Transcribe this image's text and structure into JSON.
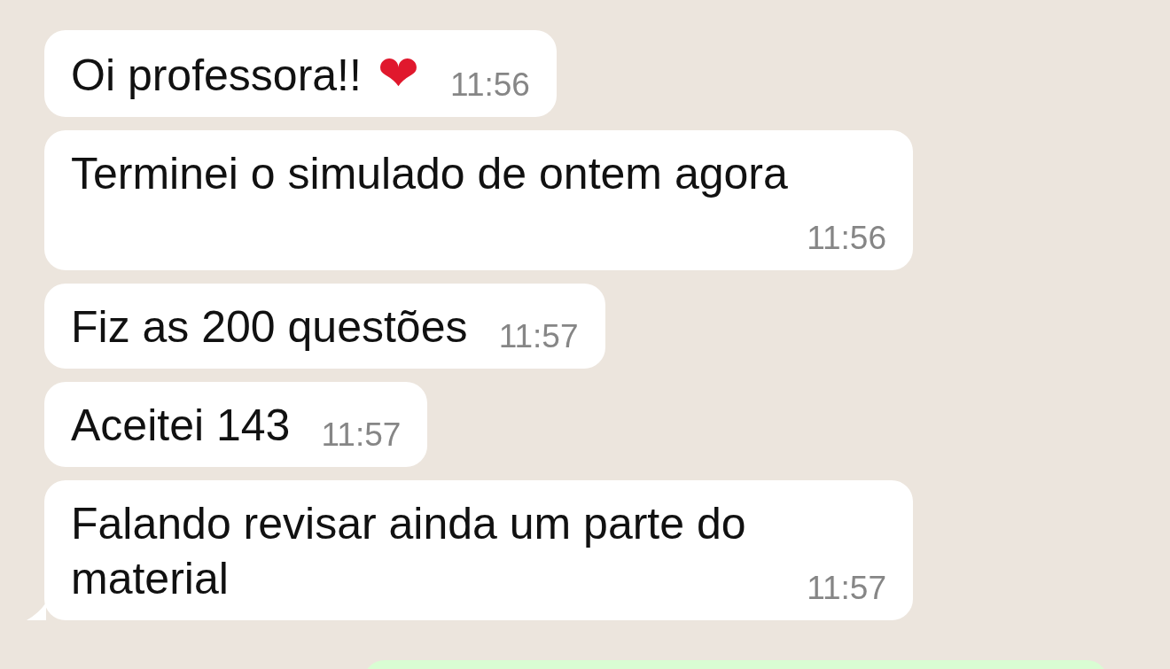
{
  "messages": [
    {
      "kind": "incoming",
      "text": "Oi professora!!",
      "emoji": "❤",
      "time": "11:56",
      "tail": false
    },
    {
      "kind": "incoming",
      "text": "Terminei o simulado de ontem agora",
      "time": "11:56",
      "tail": false
    },
    {
      "kind": "incoming",
      "text": "Fiz as 200 questões",
      "time": "11:57",
      "tail": false
    },
    {
      "kind": "incoming",
      "text": "Aceitei 143",
      "time": "11:57",
      "tail": false
    },
    {
      "kind": "incoming",
      "text": "Falando revisar ainda um parte do material",
      "time": "11:57",
      "tail": true
    },
    {
      "kind": "outgoing"
    }
  ]
}
